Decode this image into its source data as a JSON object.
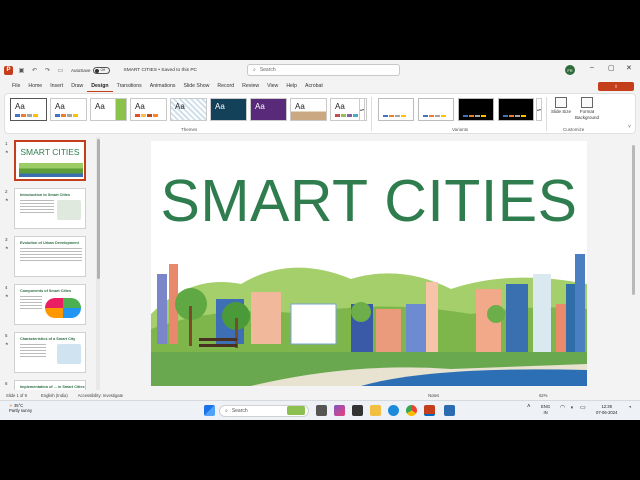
{
  "titlebar": {
    "autosave_label": "AutoSave",
    "autosave_state": "Off",
    "document_title": "SMART CITIES • Saved to this PC",
    "search_placeholder": "Search",
    "user_initials": "FR"
  },
  "menu": {
    "tabs": [
      "File",
      "Home",
      "Insert",
      "Draw",
      "Design",
      "Transitions",
      "Animations",
      "Slide Show",
      "Record",
      "Review",
      "View",
      "Help",
      "Acrobat"
    ],
    "active_tab": "Design"
  },
  "ribbon": {
    "theme_sample_text": "Aa",
    "themes_group_label": "Themes",
    "variants_group_label": "Variants",
    "customize_group_label": "Customize",
    "slide_size_label": "Slide Size",
    "format_background_label": "Format Background"
  },
  "slides": [
    {
      "number": "1",
      "title": "SMART CITIES"
    },
    {
      "number": "2",
      "title": "Introduction to Smart Cities"
    },
    {
      "number": "3",
      "title": "Evolution of Urban Development"
    },
    {
      "number": "4",
      "title": "Components of Smart Cities"
    },
    {
      "number": "5",
      "title": "Characteristics of a Smart City"
    },
    {
      "number": "6",
      "title": "Implementation of ... in Smart Cities"
    }
  ],
  "main_slide": {
    "title": "SMART CITIES"
  },
  "statusbar": {
    "slide_count": "Slide 1 of 9",
    "language": "English (India)",
    "accessibility": "Accessibility: Investigate",
    "notes": "Notes",
    "zoom": "62%"
  },
  "taskbar": {
    "weather_temp": "35°C",
    "weather_text": "Partly sunny",
    "search_placeholder": "Search",
    "language_top": "ENG",
    "language_bottom": "IN",
    "time": "12:39",
    "date": "07-06-2024"
  },
  "colors": {
    "accent": "#c43e1c",
    "title_green": "#2f7d4f"
  }
}
